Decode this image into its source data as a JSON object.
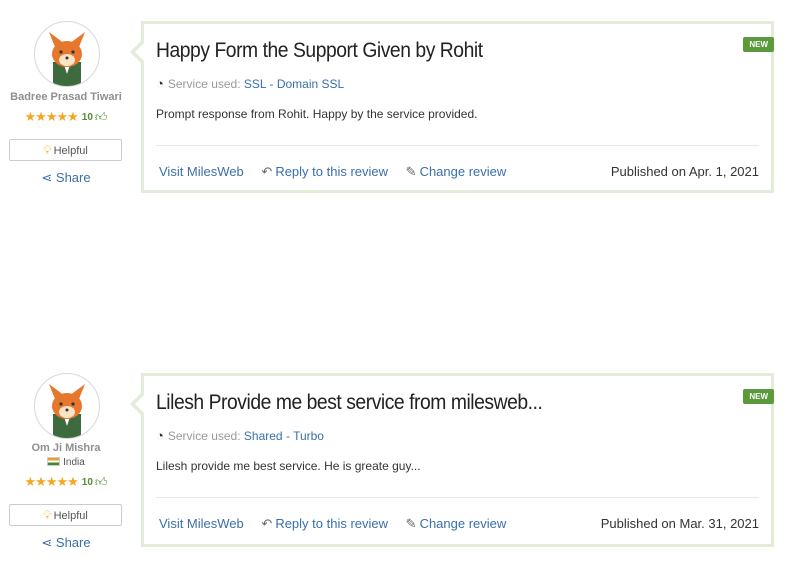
{
  "reviews": [
    {
      "author": "Badree Prasad Tiwari",
      "country": "",
      "rating_count": "10",
      "stars": "★★★★★",
      "helpful_label": "Helpful",
      "share_label": "Share",
      "badge": "NEW",
      "title": "Happy Form the Support Given by Rohit",
      "service_label": "Service used:",
      "service_primary": "SSL",
      "service_sep": " - ",
      "service_secondary": "Domain SSL",
      "body": "Prompt response from Rohit. Happy by the service provided.",
      "visit_label": "Visit MilesWeb",
      "reply_label": "Reply to this review",
      "change_label": "Change review",
      "published": "Published on Apr. 1, 2021"
    },
    {
      "author": "Om Ji Mishra",
      "country": "India",
      "rating_count": "10",
      "stars": "★★★★★",
      "helpful_label": "Helpful",
      "share_label": "Share",
      "badge": "NEW",
      "title": "Lilesh Provide me best service from milesweb...",
      "service_label": "Service used:",
      "service_primary": "Shared",
      "service_sep": " - ",
      "service_secondary": "Turbo",
      "body": "Lilesh provide me best service. He is greate guy...",
      "visit_label": "Visit MilesWeb",
      "reply_label": "Reply to this review",
      "change_label": "Change review",
      "published": "Published on Mar. 31, 2021"
    }
  ],
  "icons": {
    "avatar": "fox-avatar-icon",
    "gauge": "gauge-icon",
    "reply": "reply-icon",
    "edit": "edit-icon",
    "share": "share-icon",
    "bulb": "bulb-icon",
    "thumb": "thumbs-up-icon"
  },
  "colors": {
    "card_border": "#e3ecd9",
    "badge": "#5a9a3a",
    "link": "#3a6fa8",
    "star": "#f5a623"
  }
}
